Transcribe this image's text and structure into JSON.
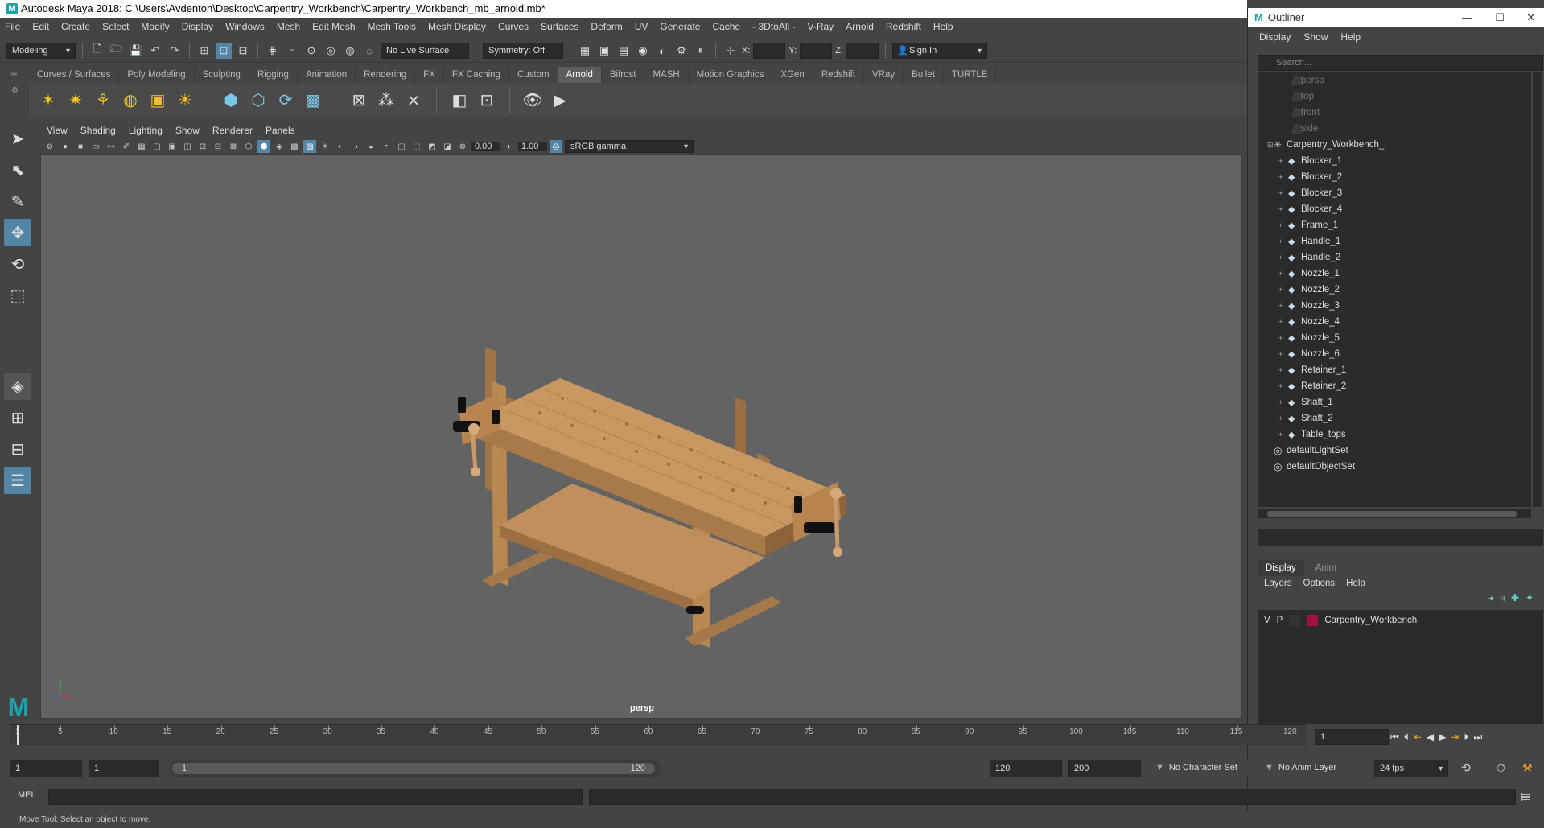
{
  "app": {
    "title": "Autodesk Maya 2018: C:\\Users\\Avdenton\\Desktop\\Carpentry_Workbench\\Carpentry_Workbench_mb_arnold.mb*",
    "logo": "M"
  },
  "menubar": [
    "File",
    "Edit",
    "Create",
    "Select",
    "Modify",
    "Display",
    "Windows",
    "Mesh",
    "Edit Mesh",
    "Mesh Tools",
    "Mesh Display",
    "Curves",
    "Surfaces",
    "Deform",
    "UV",
    "Generate",
    "Cache",
    "- 3DtoAll -",
    "V-Ray",
    "Arnold",
    "Redshift",
    "Help"
  ],
  "statusline": {
    "menuset": "Modeling",
    "live_surface": "No Live Surface",
    "symmetry": "Symmetry: Off",
    "x_label": "X:",
    "y_label": "Y:",
    "z_label": "Z:",
    "sign_in": "Sign In"
  },
  "shelf": {
    "tabs": [
      "Curves / Surfaces",
      "Poly Modeling",
      "Sculpting",
      "Rigging",
      "Animation",
      "Rendering",
      "FX",
      "FX Caching",
      "Custom",
      "Arnold",
      "Bifrost",
      "MASH",
      "Motion Graphics",
      "XGen",
      "Redshift",
      "VRay",
      "Bullet",
      "TURTLE"
    ],
    "active_tab": "Arnold"
  },
  "viewport": {
    "menus": [
      "View",
      "Shading",
      "Lighting",
      "Show",
      "Renderer",
      "Panels"
    ],
    "exposure": "0.00",
    "gamma": "1.00",
    "color_space": "sRGB gamma",
    "camera_label": "persp"
  },
  "outliner": {
    "title": "Outliner",
    "menus": [
      "Display",
      "Show",
      "Help"
    ],
    "search_placeholder": "Search...",
    "items": [
      {
        "label": "persp",
        "kind": "camera",
        "dim": true,
        "indent": 2
      },
      {
        "label": "top",
        "kind": "camera",
        "dim": true,
        "indent": 2
      },
      {
        "label": "front",
        "kind": "camera",
        "dim": true,
        "indent": 2
      },
      {
        "label": "side",
        "kind": "camera",
        "dim": true,
        "indent": 2
      },
      {
        "label": "Carpentry_Workbench_",
        "kind": "group",
        "dim": false,
        "indent": 1
      },
      {
        "label": "Blocker_1",
        "kind": "mesh",
        "dim": false,
        "indent": 2
      },
      {
        "label": "Blocker_2",
        "kind": "mesh",
        "dim": false,
        "indent": 2
      },
      {
        "label": "Blocker_3",
        "kind": "mesh",
        "dim": false,
        "indent": 2
      },
      {
        "label": "Blocker_4",
        "kind": "mesh",
        "dim": false,
        "indent": 2
      },
      {
        "label": "Frame_1",
        "kind": "mesh",
        "dim": false,
        "indent": 2
      },
      {
        "label": "Handle_1",
        "kind": "mesh",
        "dim": false,
        "indent": 2
      },
      {
        "label": "Handle_2",
        "kind": "mesh",
        "dim": false,
        "indent": 2
      },
      {
        "label": "Nozzle_1",
        "kind": "mesh",
        "dim": false,
        "indent": 2
      },
      {
        "label": "Nozzle_2",
        "kind": "mesh",
        "dim": false,
        "indent": 2
      },
      {
        "label": "Nozzle_3",
        "kind": "mesh",
        "dim": false,
        "indent": 2
      },
      {
        "label": "Nozzle_4",
        "kind": "mesh",
        "dim": false,
        "indent": 2
      },
      {
        "label": "Nozzle_5",
        "kind": "mesh",
        "dim": false,
        "indent": 2
      },
      {
        "label": "Nozzle_6",
        "kind": "mesh",
        "dim": false,
        "indent": 2
      },
      {
        "label": "Retainer_1",
        "kind": "mesh",
        "dim": false,
        "indent": 2
      },
      {
        "label": "Retainer_2",
        "kind": "mesh",
        "dim": false,
        "indent": 2
      },
      {
        "label": "Shaft_1",
        "kind": "mesh",
        "dim": false,
        "indent": 2
      },
      {
        "label": "Shaft_2",
        "kind": "mesh",
        "dim": false,
        "indent": 2
      },
      {
        "label": "Table_tops",
        "kind": "mesh",
        "dim": false,
        "indent": 2
      },
      {
        "label": "defaultLightSet",
        "kind": "set",
        "dim": false,
        "indent": 1
      },
      {
        "label": "defaultObjectSet",
        "kind": "set",
        "dim": false,
        "indent": 1
      }
    ]
  },
  "layer_editor": {
    "tabs": [
      "Display",
      "Anim"
    ],
    "active_tab": "Display",
    "menus": [
      "Layers",
      "Options",
      "Help"
    ],
    "layer": {
      "v": "V",
      "p": "P",
      "name": "Carpentry_Workbench",
      "color": "#a0143a"
    }
  },
  "timeline": {
    "ticks": [
      "1",
      "5",
      "10",
      "15",
      "20",
      "25",
      "30",
      "35",
      "40",
      "45",
      "50",
      "55",
      "60",
      "65",
      "70",
      "75",
      "80",
      "85",
      "90",
      "95",
      "100",
      "105",
      "110",
      "115",
      "120"
    ],
    "current_frame": "1"
  },
  "range": {
    "start": "1",
    "playback_start": "1",
    "range_start": "1",
    "range_end": "120",
    "playback_end": "120",
    "end": "200",
    "character_set": "No Character Set",
    "anim_layer": "No Anim Layer",
    "fps": "24 fps"
  },
  "command": {
    "mel_label": "MEL",
    "help_text": "Move Tool: Select an object to move."
  },
  "colors": {
    "accent": "#5285a6",
    "layer_color": "#a0143a",
    "maya_teal": "#1fa0a8"
  }
}
